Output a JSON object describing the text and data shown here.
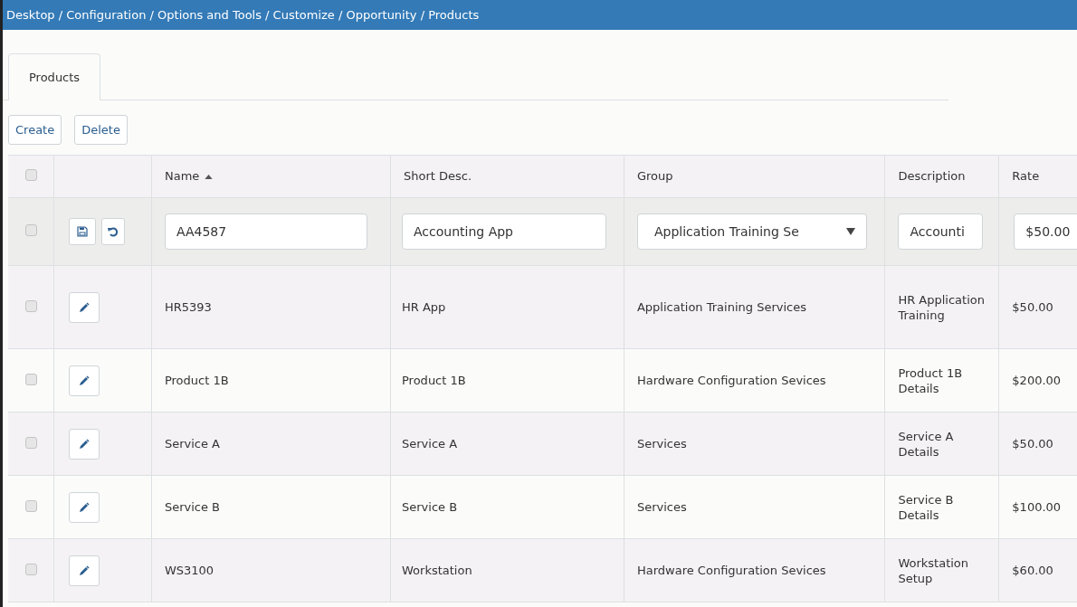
{
  "breadcrumb": "Desktop / Configuration / Options and Tools / Customize / Opportunity / Products",
  "tabs": [
    {
      "label": "Products",
      "selected": true
    }
  ],
  "toolbar_buttons": [
    "Create",
    "Delete"
  ],
  "table": {
    "select_all_checked": false,
    "columns": [
      {
        "label": "Name",
        "sorted_ascending": true
      },
      {
        "label": "Short Desc."
      },
      {
        "label": "Group"
      },
      {
        "label": "Description"
      },
      {
        "label": "Rate"
      }
    ],
    "edit_row": {
      "checked": false,
      "name": "AA4587",
      "short_desc": "Accounting App",
      "group": "Application Training Se",
      "description": "Accounti",
      "rate": "$50.00"
    },
    "rows": [
      {
        "checked": false,
        "name": "HR5393",
        "short_desc": "HR App",
        "group": "Application Training Services",
        "description": "HR Application Training",
        "rate": "$50.00"
      },
      {
        "checked": false,
        "name": "Product 1B",
        "short_desc": "Product 1B",
        "group": "Hardware Configuration Sevices",
        "description": "Product 1B Details",
        "rate": "$200.00"
      },
      {
        "checked": false,
        "name": "Service A",
        "short_desc": "Service A",
        "group": "Services",
        "description": "Service A Details",
        "rate": "$50.00"
      },
      {
        "checked": false,
        "name": "Service B",
        "short_desc": "Service B",
        "group": "Services",
        "description": "Service B Details",
        "rate": "$100.00"
      },
      {
        "checked": false,
        "name": "WS3100",
        "short_desc": "Workstation",
        "group": "Hardware Configuration Sevices",
        "description": "Workstation Setup",
        "rate": "$60.00"
      }
    ]
  }
}
